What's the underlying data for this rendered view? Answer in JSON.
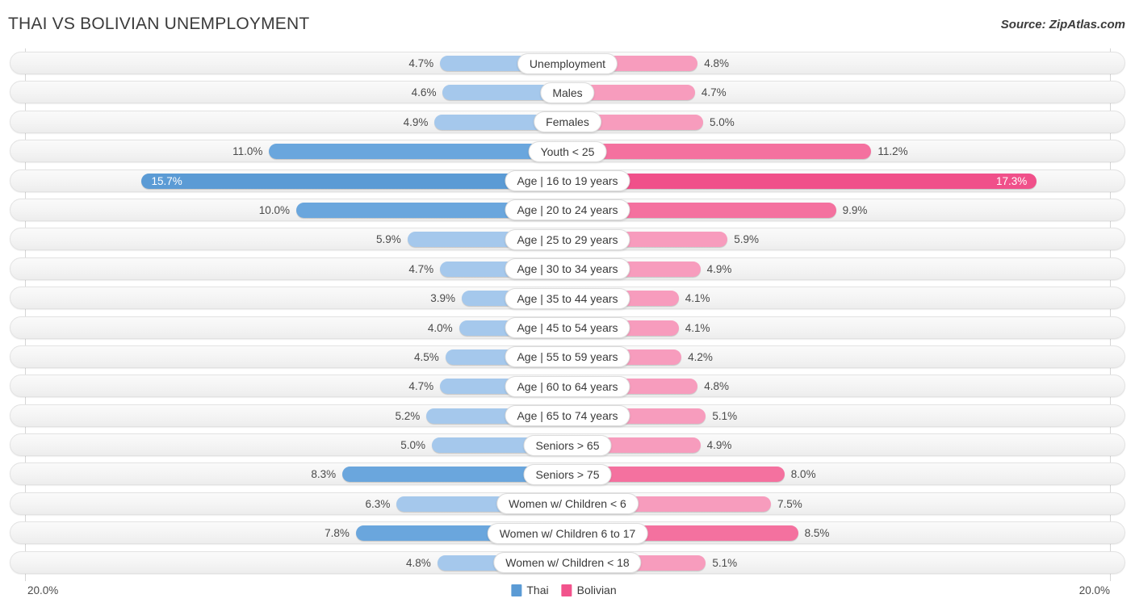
{
  "header": {
    "title": "THAI VS BOLIVIAN UNEMPLOYMENT",
    "source": "Source: ZipAtlas.com"
  },
  "axis": {
    "left_max_label": "20.0%",
    "right_max_label": "20.0%",
    "max": 20.0
  },
  "legend": {
    "items": [
      {
        "label": "Thai",
        "color": "#5b9bd5"
      },
      {
        "label": "Bolivian",
        "color": "#f2538c"
      }
    ]
  },
  "colors": {
    "thai_light": "#a5c8ec",
    "thai_dark": "#6aa6dd",
    "thai_darkest": "#5b9bd5",
    "bolivian_light": "#f79cbd",
    "bolivian_dark": "#f4719f",
    "bolivian_darkest": "#f0508a"
  },
  "chart_data": {
    "type": "bar",
    "orientation": "horizontal-diverging",
    "title": "THAI VS BOLIVIAN UNEMPLOYMENT",
    "xlabel": "",
    "ylabel": "",
    "xlim": [
      20.0,
      20.0
    ],
    "grid": true,
    "legend_position": "bottom-center",
    "categories": [
      "Unemployment",
      "Males",
      "Females",
      "Youth < 25",
      "Age | 16 to 19 years",
      "Age | 20 to 24 years",
      "Age | 25 to 29 years",
      "Age | 30 to 34 years",
      "Age | 35 to 44 years",
      "Age | 45 to 54 years",
      "Age | 55 to 59 years",
      "Age | 60 to 64 years",
      "Age | 65 to 74 years",
      "Seniors > 65",
      "Seniors > 75",
      "Women w/ Children < 6",
      "Women w/ Children 6 to 17",
      "Women w/ Children < 18"
    ],
    "series": [
      {
        "name": "Thai",
        "color": "#5b9bd5",
        "side": "left",
        "values": [
          4.7,
          4.6,
          4.9,
          11.0,
          15.7,
          10.0,
          5.9,
          4.7,
          3.9,
          4.0,
          4.5,
          4.7,
          5.2,
          5.0,
          8.3,
          6.3,
          7.8,
          4.8
        ],
        "labels": [
          "4.7%",
          "4.6%",
          "4.9%",
          "11.0%",
          "15.7%",
          "10.0%",
          "5.9%",
          "4.7%",
          "3.9%",
          "4.0%",
          "4.5%",
          "4.7%",
          "5.2%",
          "5.0%",
          "8.3%",
          "6.3%",
          "7.8%",
          "4.8%"
        ]
      },
      {
        "name": "Bolivian",
        "color": "#f2538c",
        "side": "right",
        "values": [
          4.8,
          4.7,
          5.0,
          11.2,
          17.3,
          9.9,
          5.9,
          4.9,
          4.1,
          4.1,
          4.2,
          4.8,
          5.1,
          4.9,
          8.0,
          7.5,
          8.5,
          5.1
        ],
        "labels": [
          "4.8%",
          "4.7%",
          "5.0%",
          "11.2%",
          "17.3%",
          "9.9%",
          "5.9%",
          "4.9%",
          "4.1%",
          "4.1%",
          "4.2%",
          "4.8%",
          "5.1%",
          "4.9%",
          "8.0%",
          "7.5%",
          "8.5%",
          "5.1%"
        ]
      }
    ]
  },
  "rows": [
    {
      "label": "Unemployment",
      "left_value": 4.7,
      "left_label": "4.7%",
      "right_value": 4.8,
      "right_label": "4.8%",
      "left_color": "#a5c8ec",
      "right_color": "#f79cbd",
      "label_inside": false
    },
    {
      "label": "Males",
      "left_value": 4.6,
      "left_label": "4.6%",
      "right_value": 4.7,
      "right_label": "4.7%",
      "left_color": "#a5c8ec",
      "right_color": "#f79cbd",
      "label_inside": false
    },
    {
      "label": "Females",
      "left_value": 4.9,
      "left_label": "4.9%",
      "right_value": 5.0,
      "right_label": "5.0%",
      "left_color": "#a5c8ec",
      "right_color": "#f79cbd",
      "label_inside": false
    },
    {
      "label": "Youth < 25",
      "left_value": 11.0,
      "left_label": "11.0%",
      "right_value": 11.2,
      "right_label": "11.2%",
      "left_color": "#6aa6dd",
      "right_color": "#f4719f",
      "label_inside": false
    },
    {
      "label": "Age | 16 to 19 years",
      "left_value": 15.7,
      "left_label": "15.7%",
      "right_value": 17.3,
      "right_label": "17.3%",
      "left_color": "#5b9bd5",
      "right_color": "#f0508a",
      "label_inside": true
    },
    {
      "label": "Age | 20 to 24 years",
      "left_value": 10.0,
      "left_label": "10.0%",
      "right_value": 9.9,
      "right_label": "9.9%",
      "left_color": "#6aa6dd",
      "right_color": "#f4719f",
      "label_inside": false
    },
    {
      "label": "Age | 25 to 29 years",
      "left_value": 5.9,
      "left_label": "5.9%",
      "right_value": 5.9,
      "right_label": "5.9%",
      "left_color": "#a5c8ec",
      "right_color": "#f79cbd",
      "label_inside": false
    },
    {
      "label": "Age | 30 to 34 years",
      "left_value": 4.7,
      "left_label": "4.7%",
      "right_value": 4.9,
      "right_label": "4.9%",
      "left_color": "#a5c8ec",
      "right_color": "#f79cbd",
      "label_inside": false
    },
    {
      "label": "Age | 35 to 44 years",
      "left_value": 3.9,
      "left_label": "3.9%",
      "right_value": 4.1,
      "right_label": "4.1%",
      "left_color": "#a5c8ec",
      "right_color": "#f79cbd",
      "label_inside": false
    },
    {
      "label": "Age | 45 to 54 years",
      "left_value": 4.0,
      "left_label": "4.0%",
      "right_value": 4.1,
      "right_label": "4.1%",
      "left_color": "#a5c8ec",
      "right_color": "#f79cbd",
      "label_inside": false
    },
    {
      "label": "Age | 55 to 59 years",
      "left_value": 4.5,
      "left_label": "4.5%",
      "right_value": 4.2,
      "right_label": "4.2%",
      "left_color": "#a5c8ec",
      "right_color": "#f79cbd",
      "label_inside": false
    },
    {
      "label": "Age | 60 to 64 years",
      "left_value": 4.7,
      "left_label": "4.7%",
      "right_value": 4.8,
      "right_label": "4.8%",
      "left_color": "#a5c8ec",
      "right_color": "#f79cbd",
      "label_inside": false
    },
    {
      "label": "Age | 65 to 74 years",
      "left_value": 5.2,
      "left_label": "5.2%",
      "right_value": 5.1,
      "right_label": "5.1%",
      "left_color": "#a5c8ec",
      "right_color": "#f79cbd",
      "label_inside": false
    },
    {
      "label": "Seniors > 65",
      "left_value": 5.0,
      "left_label": "5.0%",
      "right_value": 4.9,
      "right_label": "4.9%",
      "left_color": "#a5c8ec",
      "right_color": "#f79cbd",
      "label_inside": false
    },
    {
      "label": "Seniors > 75",
      "left_value": 8.3,
      "left_label": "8.3%",
      "right_value": 8.0,
      "right_label": "8.0%",
      "left_color": "#6aa6dd",
      "right_color": "#f4719f",
      "label_inside": false
    },
    {
      "label": "Women w/ Children < 6",
      "left_value": 6.3,
      "left_label": "6.3%",
      "right_value": 7.5,
      "right_label": "7.5%",
      "left_color": "#a5c8ec",
      "right_color": "#f79cbd",
      "label_inside": false
    },
    {
      "label": "Women w/ Children 6 to 17",
      "left_value": 7.8,
      "left_label": "7.8%",
      "right_value": 8.5,
      "right_label": "8.5%",
      "left_color": "#6aa6dd",
      "right_color": "#f4719f",
      "label_inside": false
    },
    {
      "label": "Women w/ Children < 18",
      "left_value": 4.8,
      "left_label": "4.8%",
      "right_value": 5.1,
      "right_label": "5.1%",
      "left_color": "#a5c8ec",
      "right_color": "#f79cbd",
      "label_inside": false
    }
  ]
}
